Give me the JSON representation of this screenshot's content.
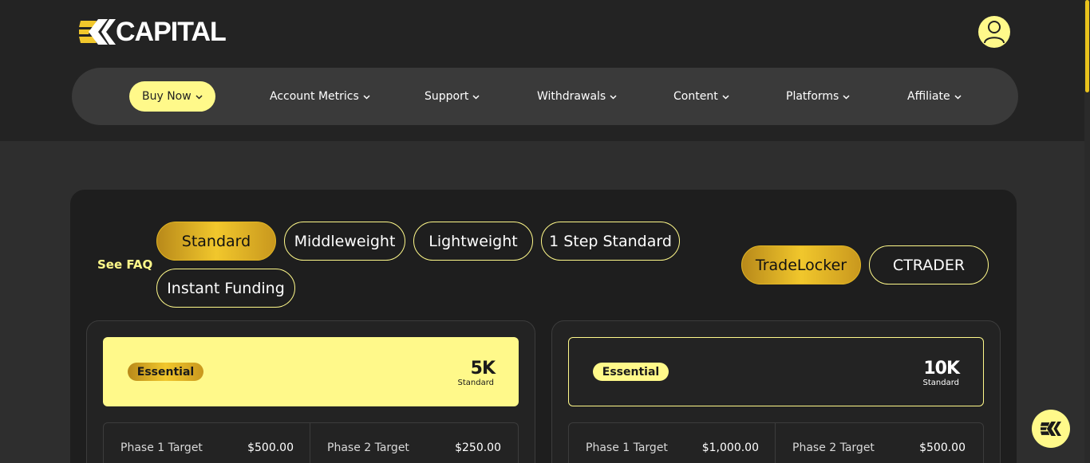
{
  "brand": {
    "name": "CAPITAL",
    "logo_icon": "ek-chevron-logo",
    "accent": "#fff98a",
    "gold": "#f1c72c"
  },
  "header": {
    "avatar_icon": "user-icon"
  },
  "nav": {
    "items": [
      {
        "label": "Buy Now",
        "active": true
      },
      {
        "label": "Account Metrics"
      },
      {
        "label": "Support"
      },
      {
        "label": "Withdrawals"
      },
      {
        "label": "Content"
      },
      {
        "label": "Platforms"
      },
      {
        "label": "Affiliate"
      }
    ]
  },
  "filters": {
    "see_faq": "See FAQ",
    "programs": [
      "Standard",
      "Middleweight",
      "Lightweight",
      "1 Step Standard",
      "Instant Funding"
    ],
    "selected_program": "Standard",
    "platforms": [
      "TradeLocker",
      "CTRADER"
    ],
    "selected_platform": "TradeLocker"
  },
  "cards": [
    {
      "badge": "Essential",
      "size": "5K",
      "size_sub": "Standard",
      "metrics": [
        {
          "label": "Phase 1 Target",
          "value": "$500.00"
        },
        {
          "label": "Phase 2 Target",
          "value": "$250.00"
        }
      ]
    },
    {
      "badge": "Essential",
      "size": "10K",
      "size_sub": "Standard",
      "metrics": [
        {
          "label": "Phase 1 Target",
          "value": "$1,000.00"
        },
        {
          "label": "Phase 2 Target",
          "value": "$500.00"
        }
      ]
    }
  ],
  "fab": {
    "icon": "ek-logo-icon"
  }
}
